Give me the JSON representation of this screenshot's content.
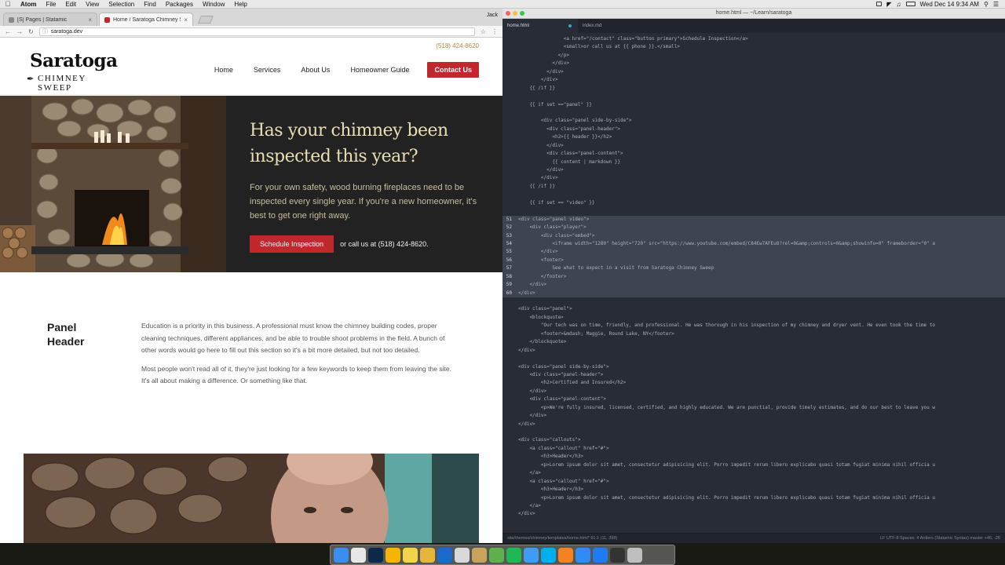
{
  "menubar": {
    "app": "Atom",
    "items": [
      "File",
      "Edit",
      "View",
      "Selection",
      "Find",
      "Packages",
      "Window",
      "Help"
    ],
    "clock": "Wed Dec 14  9:34 AM"
  },
  "browser": {
    "tabs": [
      {
        "title": "[S] Pages | Statamic"
      },
      {
        "title": "Home / Saratoga Chimney Sw"
      }
    ],
    "user": "Jack",
    "url": "saratoga.dev"
  },
  "site": {
    "logo": {
      "line1": "Saratoga",
      "line2": "CHIMNEY SWEEP"
    },
    "phone": "(518) 424-8620",
    "nav": [
      "Home",
      "Services",
      "About Us",
      "Homeowner Guide"
    ],
    "nav_cta": "Contact Us",
    "hero": {
      "title": "Has your chimney been inspected this year?",
      "body": "For your own safety, wood burning fireplaces need to be inspected every single year. If you're a new homeowner, it's best to get one right away.",
      "button": "Schedule Inspection",
      "or_text": "or call us at (518) 424-8620."
    },
    "panel": {
      "header": "Panel Header",
      "p1": "Education is a priority in this business. A professional must know the chimney building codes, proper cleaning techniques, different appliances, and be able to trouble shoot problems in the field. A bunch of other words would go here to fill out this section so it's a bit more detailed, but not too detailed.",
      "p2": "Most people won't read all of it, they're just looking for a few keywords to keep them from leaving the site. It's all about making a difference. Or something like that."
    }
  },
  "editor": {
    "title": "home.html — ~/Learn/saratoga",
    "tabs": [
      "home.html",
      "index.md"
    ],
    "lines": [
      {
        "n": "",
        "t": "                <a href=\"/contact\" class=\"button primary\">Schedule Inspection</a>"
      },
      {
        "n": "",
        "t": "                <small>or call us at {{ phone }}.</small>"
      },
      {
        "n": "",
        "t": "              </p>"
      },
      {
        "n": "",
        "t": "            </div>"
      },
      {
        "n": "",
        "t": "          </div>"
      },
      {
        "n": "",
        "t": "        </div>"
      },
      {
        "n": "",
        "t": "    {{ /if }}"
      },
      {
        "n": "",
        "t": ""
      },
      {
        "n": "",
        "t": "    {{ if set ==\"panel\" }}"
      },
      {
        "n": "",
        "t": ""
      },
      {
        "n": "",
        "t": "        <div class=\"panel side-by-side\">"
      },
      {
        "n": "",
        "t": "          <div class=\"panel-header\">"
      },
      {
        "n": "",
        "t": "            <h2>{{ header }}</h2>"
      },
      {
        "n": "",
        "t": "          </div>"
      },
      {
        "n": "",
        "t": "          <div class=\"panel-content\">"
      },
      {
        "n": "",
        "t": "            {{ content | markdown }}"
      },
      {
        "n": "",
        "t": "          </div>"
      },
      {
        "n": "",
        "t": "        </div>"
      },
      {
        "n": "",
        "t": "    {{ /if }}"
      },
      {
        "n": "",
        "t": ""
      },
      {
        "n": "",
        "t": "    {{ if set == \"video\" }}"
      },
      {
        "n": "",
        "t": ""
      },
      {
        "n": "51",
        "t": "<div class=\"panel video\">"
      },
      {
        "n": "52",
        "t": "    <div class=\"player\">"
      },
      {
        "n": "53",
        "t": "        <div class=\"embed\">"
      },
      {
        "n": "54",
        "t": "            <iframe width=\"1280\" height=\"720\" src=\"https://www.youtube.com/embed/C84Ew7AFEu8?rel=0&amp;controls=0&amp;showinfo=0\" frameborder=\"0\" a"
      },
      {
        "n": "55",
        "t": "        </div>"
      },
      {
        "n": "56",
        "t": "        <footer>"
      },
      {
        "n": "57",
        "t": "            See what to expect in a visit from Saratoga Chimney Sweep"
      },
      {
        "n": "58",
        "t": "        </footer>"
      },
      {
        "n": "59",
        "t": "    </div>"
      },
      {
        "n": "60",
        "t": "</div>"
      },
      {
        "n": "",
        "t": ""
      },
      {
        "n": "",
        "t": "<div class=\"panel\">"
      },
      {
        "n": "",
        "t": "    <blockquote>"
      },
      {
        "n": "",
        "t": "        \"Our tech was on time, friendly, and professional. He was thorough in his inspection of my chimney and dryer vent. He even took the time to"
      },
      {
        "n": "",
        "t": "        <footer>&mdash; Maggie, Round Lake, NY</footer>"
      },
      {
        "n": "",
        "t": "    </blockquote>"
      },
      {
        "n": "",
        "t": "</div>"
      },
      {
        "n": "",
        "t": ""
      },
      {
        "n": "",
        "t": "<div class=\"panel side-by-side\">"
      },
      {
        "n": "",
        "t": "    <div class=\"panel-header\">"
      },
      {
        "n": "",
        "t": "        <h2>Certified and Insured</h2>"
      },
      {
        "n": "",
        "t": "    </div>"
      },
      {
        "n": "",
        "t": "    <div class=\"panel-content\">"
      },
      {
        "n": "",
        "t": "        <p>We're fully insured, licensed, certified, and highly educated. We are punctial, provide timely estimates, and do our best to leave you w"
      },
      {
        "n": "",
        "t": "    </div>"
      },
      {
        "n": "",
        "t": "</div>"
      },
      {
        "n": "",
        "t": ""
      },
      {
        "n": "",
        "t": "<div class=\"callouts\">"
      },
      {
        "n": "",
        "t": "    <a class=\"callout\" href=\"#\">"
      },
      {
        "n": "",
        "t": "        <h3>Header</h3>"
      },
      {
        "n": "",
        "t": "        <p>Lorem ipsum dolor sit amet, consectetur adipisicing elit. Porro impedit rerum libero explicabo quasi totam fugiat minima nihil officia u"
      },
      {
        "n": "",
        "t": "    </a>"
      },
      {
        "n": "",
        "t": "    <a class=\"callout\" href=\"#\">"
      },
      {
        "n": "",
        "t": "        <h3>Header</h3>"
      },
      {
        "n": "",
        "t": "        <p>Lorem ipsum dolor sit amet, consectetur adipisicing elit. Porro impedit rerum libero explicabo quasi totam fugiat minima nihil officia u"
      },
      {
        "n": "",
        "t": "    </a>"
      },
      {
        "n": "",
        "t": "</div>"
      }
    ],
    "selected_lines": [
      "51",
      "52",
      "53",
      "54",
      "55",
      "56",
      "57",
      "58",
      "59",
      "60"
    ],
    "status_left": "site/themes/chimney/templates/home.html*   61:1   (11, 398)",
    "status_right": "LF   UTF-8   Spaces: 4   Antlers (Statamic Syntax)   master   +46, -26"
  },
  "colors": {
    "brand_red": "#c0282d",
    "hero_title": "#e9dfb2",
    "editor_bg": "#282c34"
  },
  "dock": [
    "finder-icon",
    "chrome-icon",
    "photoshop-icon",
    "sketch-icon",
    "notes-icon",
    "chrome-canary-icon",
    "1password-icon",
    "drafts-icon",
    "sequel-pro-icon",
    "atom-icon",
    "spotify-icon",
    "messages-icon",
    "skype-icon",
    "sublime-icon",
    "safari-icon",
    "appstore-icon",
    "terminal-icon",
    "trash-icon"
  ]
}
